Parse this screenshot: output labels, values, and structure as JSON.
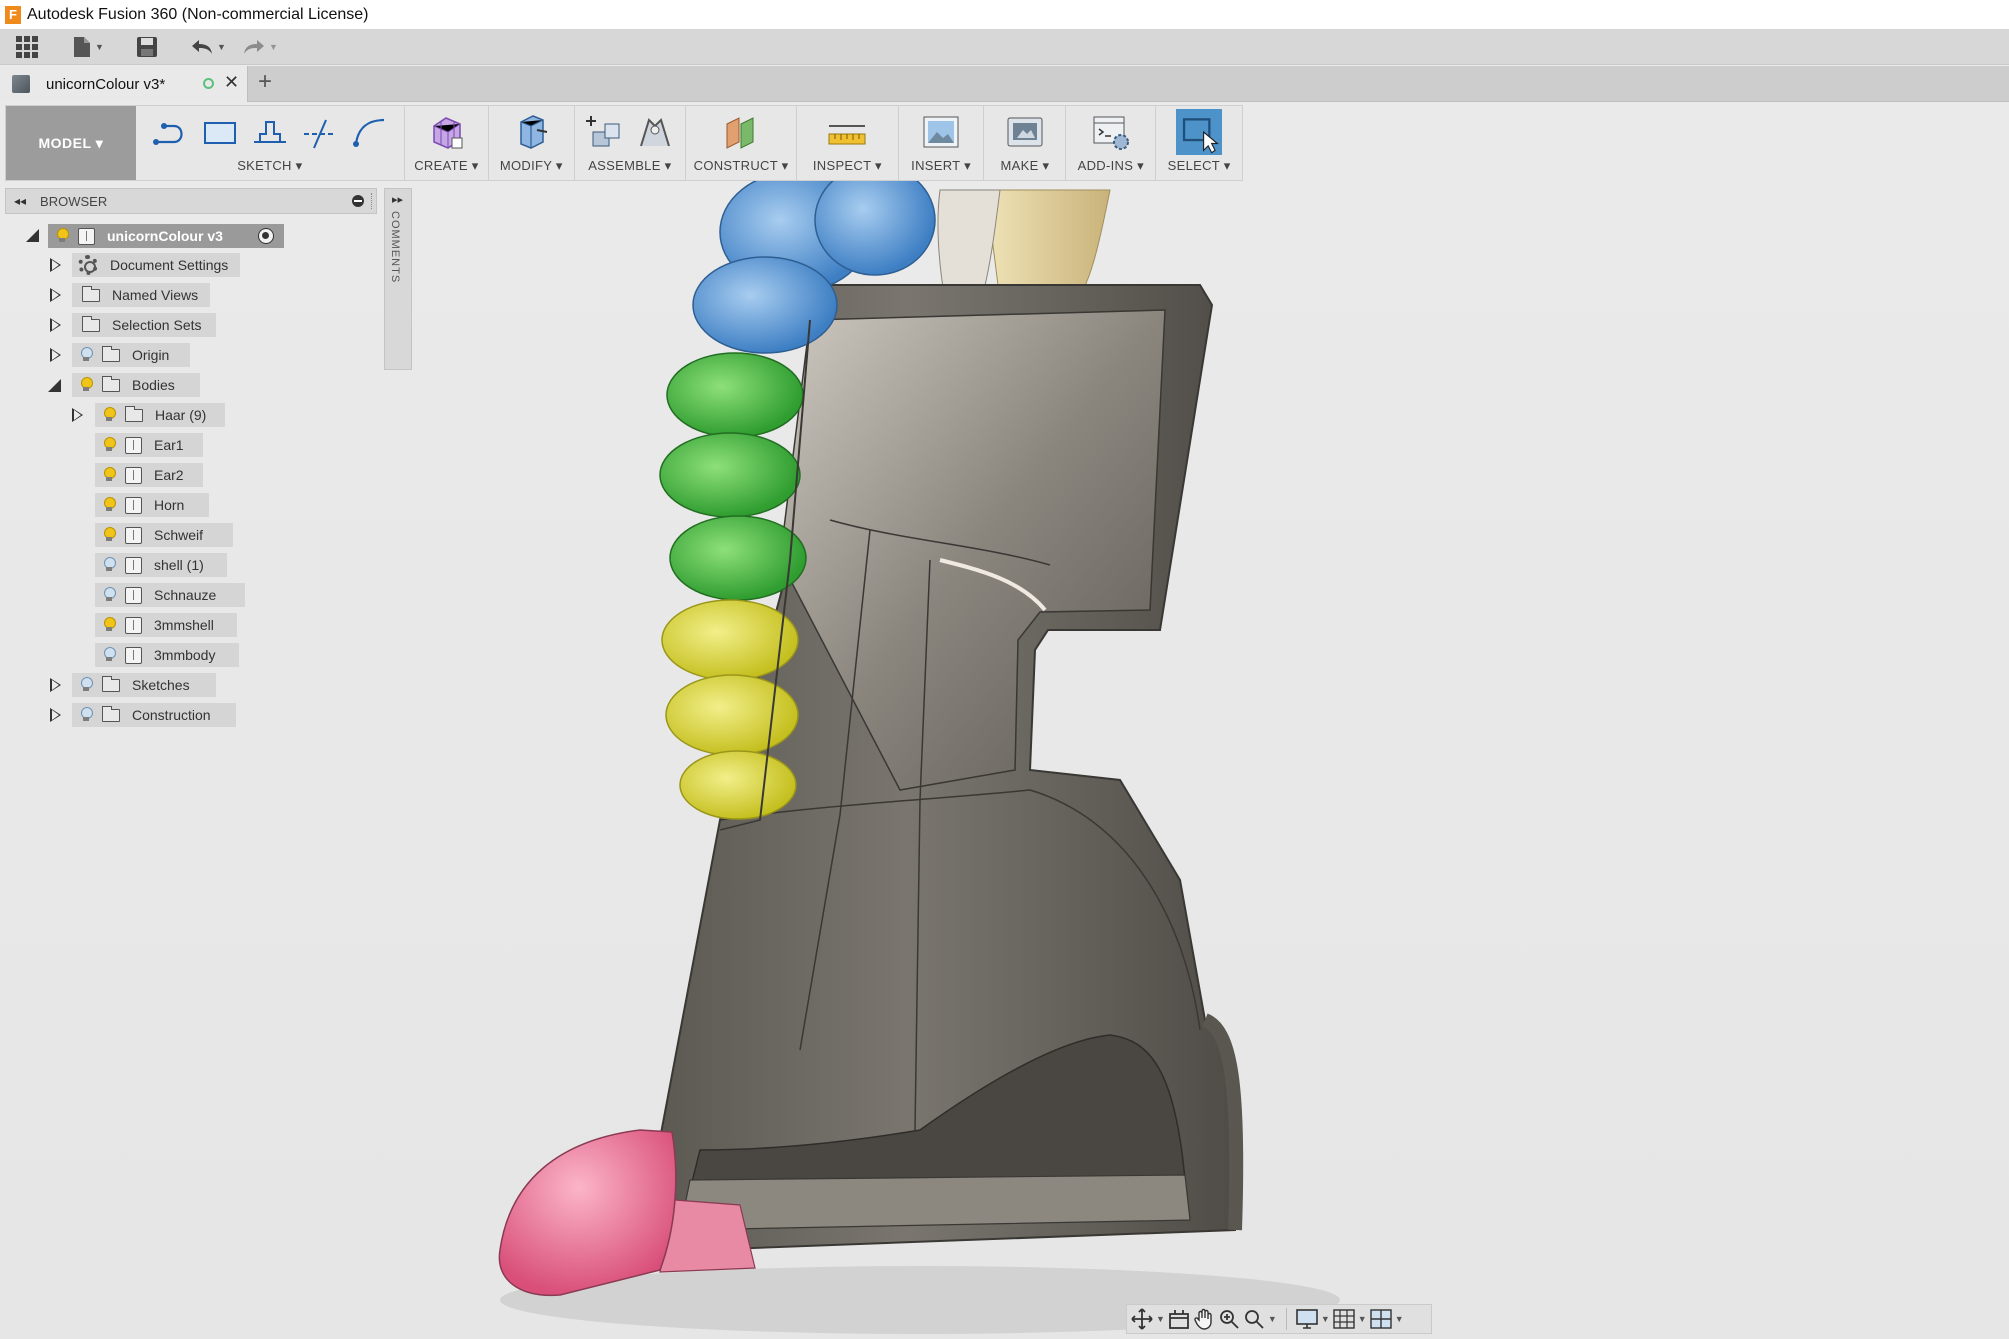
{
  "window": {
    "title": "Autodesk Fusion 360 (Non-commercial License)",
    "logo_letter": "F"
  },
  "quick_access": {
    "items": [
      "apps-grid-icon",
      "file-icon",
      "save-icon",
      "undo-icon",
      "redo-icon"
    ]
  },
  "document_tab": {
    "name": "unicornColour v3*"
  },
  "toolbar": {
    "workspace": "MODEL ▾",
    "groups": [
      {
        "label": "SKETCH ▾"
      },
      {
        "label": "CREATE ▾"
      },
      {
        "label": "MODIFY ▾"
      },
      {
        "label": "ASSEMBLE ▾"
      },
      {
        "label": "CONSTRUCT ▾"
      },
      {
        "label": "INSPECT ▾"
      },
      {
        "label": "INSERT ▾"
      },
      {
        "label": "MAKE ▾"
      },
      {
        "label": "ADD-INS ▾"
      },
      {
        "label": "SELECT ▾"
      }
    ]
  },
  "browser": {
    "title": "BROWSER",
    "comments_label": "COMMENTS",
    "root": "unicornColour v3",
    "nodes": [
      {
        "label": "Document Settings",
        "icon": "gear-icon"
      },
      {
        "label": "Named Views",
        "icon": "folder-icon"
      },
      {
        "label": "Selection Sets",
        "icon": "folder-icon"
      },
      {
        "label": "Origin",
        "icon": "folder-icon",
        "visible": false
      },
      {
        "label": "Bodies",
        "icon": "folder-icon",
        "visible": true,
        "expanded": true
      },
      {
        "label": "Haar (9)",
        "icon": "folder-icon",
        "visible": true
      },
      {
        "label": "Ear1",
        "icon": "body-icon",
        "visible": true
      },
      {
        "label": "Ear2",
        "icon": "body-icon",
        "visible": true
      },
      {
        "label": "Horn",
        "icon": "body-icon",
        "visible": true
      },
      {
        "label": "Schweif",
        "icon": "body-icon",
        "visible": true
      },
      {
        "label": "shell (1)",
        "icon": "body-icon",
        "visible": false
      },
      {
        "label": "Schnauze",
        "icon": "body-icon",
        "visible": false
      },
      {
        "label": "3mmshell",
        "icon": "body-icon",
        "visible": true
      },
      {
        "label": "3mmbody",
        "icon": "body-icon",
        "visible": false
      },
      {
        "label": "Sketches",
        "icon": "folder-icon",
        "visible": false
      },
      {
        "label": "Construction",
        "icon": "folder-icon",
        "visible": false
      }
    ]
  },
  "colors": {
    "mane_blue": "#5a96d6",
    "mane_green": "#47b043",
    "mane_yellow": "#d8d43a",
    "snout_pink": "#e8688e",
    "horn_tan": "#e9d8a0",
    "shell_gray": "#6b6761",
    "select_blue": "#4d93c9"
  },
  "navigation": {
    "items": [
      "orbit-icon",
      "look-at-icon",
      "pan-icon",
      "zoom-icon",
      "fit-icon",
      "display-settings-icon",
      "grid-icon",
      "viewports-icon"
    ]
  }
}
